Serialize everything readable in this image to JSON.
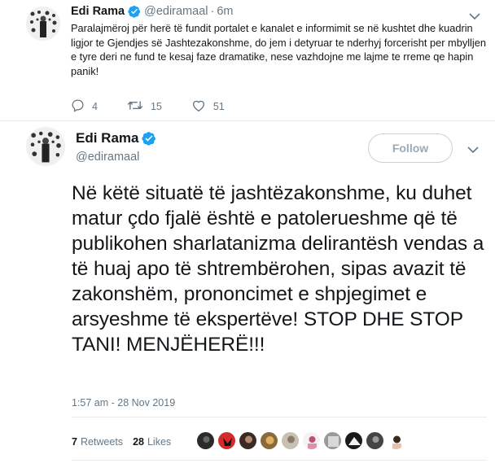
{
  "tweet1": {
    "name": "Edi Rama",
    "handle": "@ediramaal",
    "dot": "·",
    "time": "6m",
    "text": "Paralajmëroj për herë të fundit portalet e kanalet e informimit se në kushtet dhe kuadrin ligjor te Gjendjes së Jashtezakonshme, do jem i detyruar te nderhyj forcerisht per mbylljen e tyre deri ne fund te kesaj faze dramatike, nese vazhdojne me lajme te rreme qe hapin panik!",
    "replies": "4",
    "retweets": "15",
    "likes": "51"
  },
  "tweet2": {
    "name": "Edi Rama",
    "handle": "@ediramaal",
    "follow_label": "Follow",
    "text": "Në këtë situatë të jashtëzakonshme, ku duhet matur çdo fjalë është e patolerueshme që të publikohen sharlatanizma delirantësh vendas a të huaj apo të shtrembërohen, sipas avazit të zakonshëm, prononcimet e shpjegimet e arsyeshme të ekspertëve! STOP DHE STOP TANI! MENJËHERË!!!",
    "date": "1:57 am - 28 Nov 2019",
    "retweets_count": "7",
    "retweets_label": "Retweets",
    "likes_count": "28",
    "likes_label": "Likes"
  },
  "icons": {
    "verified": "verified-badge-icon",
    "caret": "chevron-down-icon",
    "reply": "reply-icon",
    "retweet": "retweet-icon",
    "like": "heart-icon"
  },
  "colors": {
    "verified": "#1da1f2",
    "secondary_text": "#657786",
    "divider": "#e6ecf0"
  }
}
